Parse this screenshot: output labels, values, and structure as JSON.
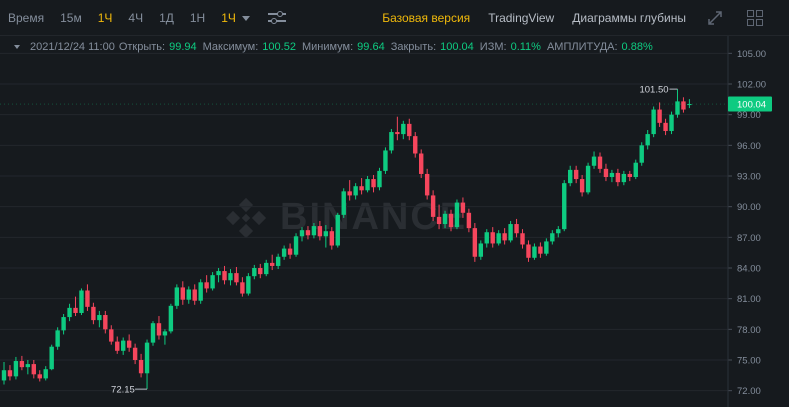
{
  "toolbar": {
    "time_label": "Время",
    "intervals": [
      "15м",
      "1Ч",
      "4Ч",
      "1Д",
      "1Н"
    ],
    "active_interval": "1Ч",
    "dropdown_label": "1Ч",
    "views": [
      "Базовая версия",
      "TradingView",
      "Диаграммы глубины"
    ]
  },
  "ohlc": {
    "date": "2021/12/24 11:00",
    "open_label": "Открыть:",
    "open": "99.94",
    "high_label": "Максимум:",
    "high": "100.52",
    "low_label": "Минимум:",
    "low": "99.64",
    "close_label": "Закрыть:",
    "close": "100.04",
    "change_label": "ИЗМ:",
    "change": "0.11%",
    "amp_label": "АМПЛИТУДА:",
    "amp": "0.88%"
  },
  "colors": {
    "up": "#0ecb81",
    "down": "#f6465d",
    "accent": "#f0b90b",
    "bg": "#161a1e",
    "grid": "#23272d"
  },
  "icons": [
    "caret-down-icon",
    "settings-sliders-icon",
    "expand-icon",
    "grid-layout-icon",
    "binance-logo-icon"
  ],
  "chart_data": {
    "type": "candlestick",
    "y_ticks": [
      "72.00",
      "75.00",
      "78.00",
      "81.00",
      "84.00",
      "87.00",
      "90.00",
      "93.00",
      "96.00",
      "99.00",
      "102.00",
      "105.00"
    ],
    "ylim": [
      70.5,
      106.5
    ],
    "last_price": "100.04",
    "high_marker": "101.50",
    "low_marker": "72.15",
    "watermark": "BINANCE",
    "candles": [
      [
        73.0,
        74.8,
        72.6,
        74.0
      ],
      [
        74.0,
        74.5,
        73.0,
        73.4
      ],
      [
        73.4,
        75.3,
        73.1,
        74.9
      ],
      [
        74.9,
        75.4,
        74.0,
        74.3
      ],
      [
        74.3,
        75.0,
        73.6,
        74.6
      ],
      [
        74.6,
        75.0,
        73.2,
        73.6
      ],
      [
        73.6,
        74.0,
        72.9,
        73.2
      ],
      [
        73.2,
        74.4,
        73.0,
        74.1
      ],
      [
        74.1,
        76.5,
        74.0,
        76.3
      ],
      [
        76.3,
        78.2,
        76.0,
        77.9
      ],
      [
        77.9,
        79.5,
        77.5,
        79.2
      ],
      [
        79.2,
        80.5,
        78.8,
        80.1
      ],
      [
        80.1,
        81.2,
        79.3,
        79.6
      ],
      [
        79.6,
        82.0,
        79.4,
        81.8
      ],
      [
        81.8,
        82.4,
        79.8,
        80.2
      ],
      [
        80.2,
        80.6,
        78.5,
        78.9
      ],
      [
        78.9,
        79.8,
        78.2,
        79.4
      ],
      [
        79.4,
        79.8,
        77.6,
        78.0
      ],
      [
        78.0,
        78.4,
        76.5,
        76.8
      ],
      [
        76.8,
        77.3,
        75.6,
        75.9
      ],
      [
        75.9,
        77.2,
        75.5,
        76.9
      ],
      [
        76.9,
        77.5,
        75.8,
        76.2
      ],
      [
        76.2,
        76.6,
        74.6,
        75.0
      ],
      [
        75.0,
        75.6,
        73.3,
        73.7
      ],
      [
        73.7,
        77.0,
        72.15,
        76.7
      ],
      [
        76.7,
        78.8,
        76.4,
        78.6
      ],
      [
        78.6,
        79.3,
        77.0,
        77.4
      ],
      [
        77.4,
        78.0,
        76.5,
        77.8
      ],
      [
        77.8,
        80.5,
        77.6,
        80.3
      ],
      [
        80.3,
        82.4,
        80.0,
        82.1
      ],
      [
        82.1,
        82.7,
        80.4,
        80.9
      ],
      [
        80.9,
        82.2,
        80.5,
        81.9
      ],
      [
        81.9,
        82.4,
        80.4,
        80.8
      ],
      [
        80.8,
        82.9,
        80.5,
        82.6
      ],
      [
        82.6,
        83.3,
        81.6,
        82.0
      ],
      [
        82.0,
        83.6,
        81.8,
        83.3
      ],
      [
        83.3,
        84.0,
        82.6,
        83.7
      ],
      [
        83.7,
        84.2,
        82.4,
        82.8
      ],
      [
        82.8,
        83.9,
        82.3,
        83.5
      ],
      [
        83.5,
        84.1,
        82.3,
        82.6
      ],
      [
        82.6,
        83.1,
        81.2,
        81.5
      ],
      [
        81.5,
        83.5,
        81.3,
        83.2
      ],
      [
        83.2,
        84.3,
        82.9,
        84.0
      ],
      [
        84.0,
        84.4,
        83.0,
        83.4
      ],
      [
        83.4,
        84.8,
        83.2,
        84.5
      ],
      [
        84.5,
        85.3,
        83.8,
        84.2
      ],
      [
        84.2,
        85.4,
        83.9,
        85.1
      ],
      [
        85.1,
        86.2,
        84.8,
        85.9
      ],
      [
        85.9,
        86.4,
        84.9,
        85.3
      ],
      [
        85.3,
        87.4,
        85.1,
        87.1
      ],
      [
        87.1,
        88.0,
        86.6,
        87.7
      ],
      [
        87.7,
        88.1,
        86.8,
        87.2
      ],
      [
        87.2,
        88.4,
        86.9,
        88.1
      ],
      [
        88.1,
        88.6,
        86.7,
        87.1
      ],
      [
        87.1,
        88.2,
        86.0,
        87.6
      ],
      [
        87.6,
        88.0,
        85.8,
        86.2
      ],
      [
        86.2,
        89.4,
        86.0,
        89.2
      ],
      [
        89.2,
        91.8,
        88.9,
        91.5
      ],
      [
        91.5,
        92.6,
        90.6,
        91.1
      ],
      [
        91.1,
        92.3,
        90.7,
        92.0
      ],
      [
        92.0,
        92.8,
        91.2,
        91.6
      ],
      [
        91.6,
        93.0,
        91.4,
        92.7
      ],
      [
        92.7,
        93.1,
        91.4,
        91.9
      ],
      [
        91.9,
        93.8,
        91.6,
        93.5
      ],
      [
        93.5,
        95.8,
        93.2,
        95.5
      ],
      [
        95.5,
        97.6,
        95.2,
        97.3
      ],
      [
        97.3,
        98.8,
        96.5,
        97.1
      ],
      [
        97.1,
        98.4,
        96.6,
        98.1
      ],
      [
        98.1,
        98.6,
        96.5,
        96.9
      ],
      [
        96.9,
        97.3,
        94.8,
        95.2
      ],
      [
        95.2,
        95.6,
        92.8,
        93.2
      ],
      [
        93.2,
        93.7,
        90.7,
        91.1
      ],
      [
        91.1,
        91.6,
        88.6,
        89.0
      ],
      [
        89.0,
        90.2,
        87.8,
        88.3
      ],
      [
        88.3,
        89.6,
        87.9,
        89.3
      ],
      [
        89.3,
        89.7,
        87.6,
        88.0
      ],
      [
        88.0,
        90.7,
        87.8,
        90.4
      ],
      [
        90.4,
        90.9,
        88.9,
        89.4
      ],
      [
        89.4,
        89.8,
        87.5,
        87.9
      ],
      [
        87.9,
        88.4,
        84.6,
        85.1
      ],
      [
        85.1,
        86.7,
        84.8,
        86.4
      ],
      [
        86.4,
        87.8,
        86.0,
        87.5
      ],
      [
        87.5,
        88.0,
        86.0,
        86.4
      ],
      [
        86.4,
        87.7,
        86.2,
        87.4
      ],
      [
        87.4,
        87.9,
        86.3,
        86.7
      ],
      [
        86.7,
        88.6,
        86.5,
        88.3
      ],
      [
        88.3,
        88.8,
        87.0,
        87.4
      ],
      [
        87.4,
        87.8,
        85.9,
        86.3
      ],
      [
        86.3,
        86.7,
        84.6,
        85.0
      ],
      [
        85.0,
        86.4,
        84.8,
        86.1
      ],
      [
        86.1,
        86.5,
        85.0,
        85.4
      ],
      [
        85.4,
        86.9,
        85.2,
        86.6
      ],
      [
        86.6,
        87.7,
        86.3,
        87.4
      ],
      [
        87.4,
        88.1,
        87.0,
        87.8
      ],
      [
        87.8,
        92.6,
        87.6,
        92.3
      ],
      [
        92.3,
        94.0,
        92.0,
        93.6
      ],
      [
        93.6,
        94.0,
        92.3,
        92.7
      ],
      [
        92.7,
        93.1,
        91.0,
        91.4
      ],
      [
        91.4,
        94.3,
        91.2,
        94.0
      ],
      [
        94.0,
        95.4,
        93.7,
        94.9
      ],
      [
        94.9,
        95.3,
        93.3,
        93.7
      ],
      [
        93.7,
        94.2,
        92.5,
        92.9
      ],
      [
        92.9,
        93.6,
        92.4,
        93.3
      ],
      [
        93.3,
        93.7,
        92.0,
        92.4
      ],
      [
        92.4,
        93.5,
        92.1,
        93.2
      ],
      [
        93.2,
        93.5,
        92.5,
        92.9
      ],
      [
        92.9,
        94.6,
        92.7,
        94.3
      ],
      [
        94.3,
        96.3,
        94.0,
        96.0
      ],
      [
        96.0,
        97.5,
        95.6,
        97.1
      ],
      [
        97.1,
        99.8,
        96.8,
        99.5
      ],
      [
        99.5,
        100.2,
        97.8,
        98.2
      ],
      [
        98.2,
        98.6,
        97.0,
        97.4
      ],
      [
        97.4,
        99.3,
        97.1,
        99.0
      ],
      [
        99.0,
        101.5,
        98.7,
        100.3
      ],
      [
        100.3,
        100.7,
        99.2,
        99.5
      ],
      [
        99.94,
        100.52,
        99.64,
        100.04
      ]
    ]
  }
}
